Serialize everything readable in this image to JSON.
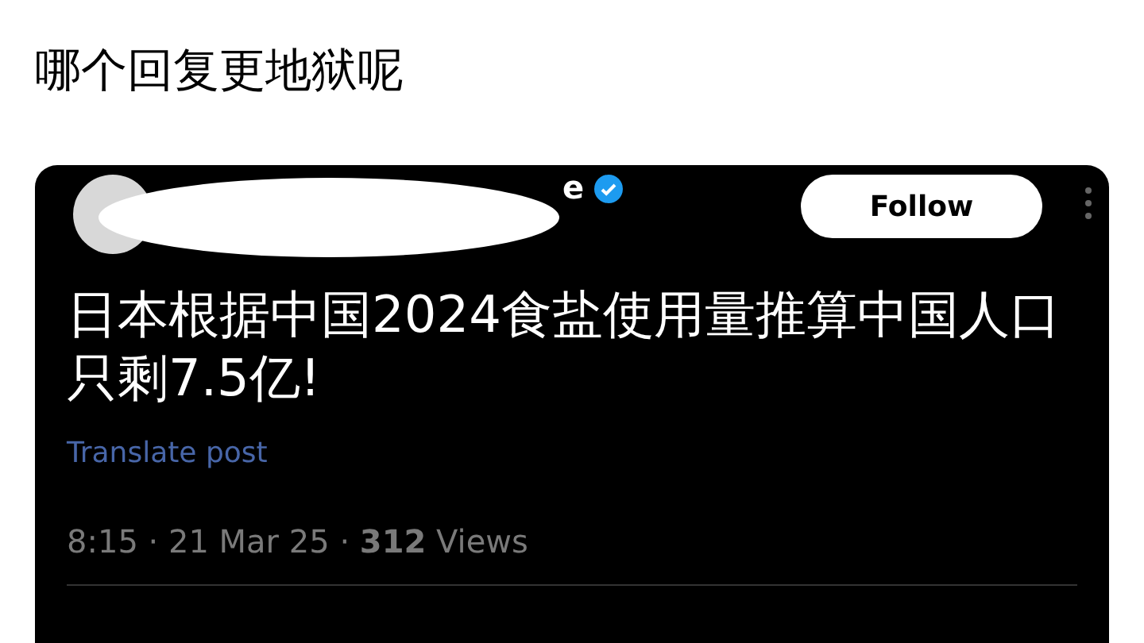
{
  "post_title": "哪个回复更地狱呢",
  "tweet": {
    "author_name_fragment": "e",
    "verified": true,
    "follow_button": "Follow",
    "text_lines": [
      "日本根据中国2024食盐使用量推算中国人口",
      "只剩7.5亿!"
    ],
    "translate_link": "Translate post",
    "meta": "8:15 · 21 Mar 25 · **312** Views"
  }
}
